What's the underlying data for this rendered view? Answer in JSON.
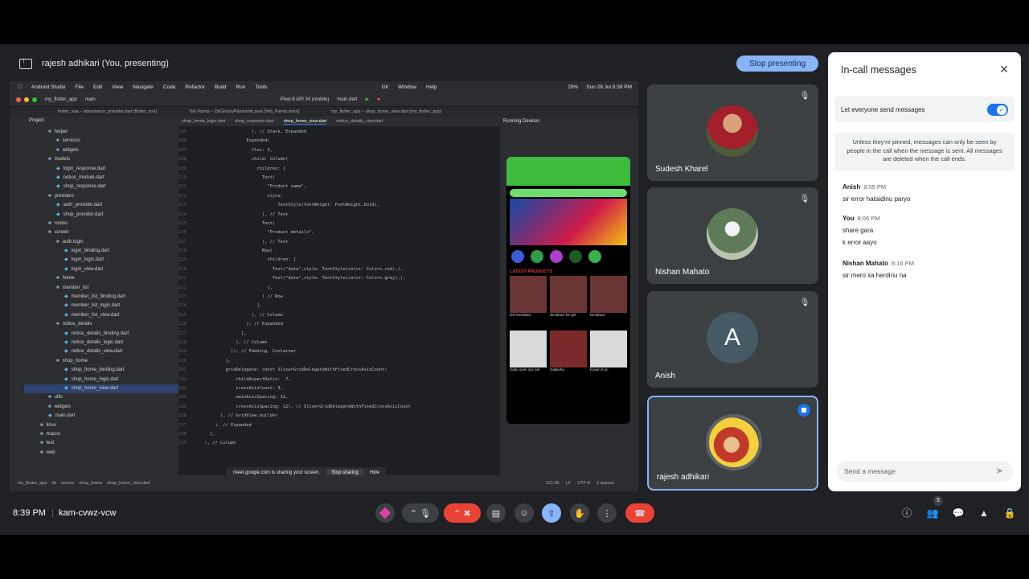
{
  "presenting": {
    "title": "rajesh adhikari (You, presenting)",
    "stop_label": "Stop presenting"
  },
  "shared_screen": {
    "mac_menu": [
      "Android Studio",
      "File",
      "Edit",
      "View",
      "Navigate",
      "Code",
      "Refactor",
      "Build",
      "Run",
      "Tools",
      "Git",
      "Window",
      "Help"
    ],
    "mac_status": {
      "battery": "29%",
      "datetime": "Sun 28 Jul  8:39 PM"
    },
    "toolbar": {
      "project": "my_flutter_app",
      "branch": "main",
      "device": "Pixel 8 API 34 (mobile)",
      "run_config": "main.dart"
    },
    "window_tabs": [
      "flutter_soa – attendance_provider.dart [flutter_soa]",
      "Yeti Paints – DbGlossyPaintsInfo.java [Yeti_Paints.main]",
      "my_flutter_app – shop_home_view.dart [my_flutter_app]"
    ],
    "project_label": "Project",
    "tree": [
      {
        "label": "helper",
        "indent": 3,
        "kind": "folder"
      },
      {
        "label": "services",
        "indent": 4,
        "kind": "folder"
      },
      {
        "label": "widgets",
        "indent": 4,
        "kind": "folder"
      },
      {
        "label": "models",
        "indent": 3,
        "kind": "folder"
      },
      {
        "label": "login_response.dart",
        "indent": 4,
        "kind": "file"
      },
      {
        "label": "notice_module.dart",
        "indent": 4,
        "kind": "file"
      },
      {
        "label": "shop_response.dart",
        "indent": 4,
        "kind": "file"
      },
      {
        "label": "providers",
        "indent": 3,
        "kind": "folder"
      },
      {
        "label": "auth_provider.dart",
        "indent": 4,
        "kind": "file"
      },
      {
        "label": "shop_provider.dart",
        "indent": 4,
        "kind": "file"
      },
      {
        "label": "routes",
        "indent": 3,
        "kind": "folder"
      },
      {
        "label": "screen",
        "indent": 3,
        "kind": "folder"
      },
      {
        "label": "auth.login",
        "indent": 4,
        "kind": "folder"
      },
      {
        "label": "login_binding.dart",
        "indent": 5,
        "kind": "file"
      },
      {
        "label": "login_logic.dart",
        "indent": 5,
        "kind": "file"
      },
      {
        "label": "login_view.dart",
        "indent": 5,
        "kind": "file"
      },
      {
        "label": "home",
        "indent": 4,
        "kind": "folder"
      },
      {
        "label": "member_list",
        "indent": 4,
        "kind": "folder"
      },
      {
        "label": "member_list_binding.dart",
        "indent": 5,
        "kind": "file"
      },
      {
        "label": "member_list_logic.dart",
        "indent": 5,
        "kind": "file"
      },
      {
        "label": "member_list_view.dart",
        "indent": 5,
        "kind": "file"
      },
      {
        "label": "notice_details",
        "indent": 4,
        "kind": "folder"
      },
      {
        "label": "notice_details_binding.dart",
        "indent": 5,
        "kind": "file"
      },
      {
        "label": "notice_details_logic.dart",
        "indent": 5,
        "kind": "file"
      },
      {
        "label": "notice_details_view.dart",
        "indent": 5,
        "kind": "file"
      },
      {
        "label": "shop_home",
        "indent": 4,
        "kind": "folder"
      },
      {
        "label": "shop_home_binding.dart",
        "indent": 5,
        "kind": "file"
      },
      {
        "label": "shop_home_logic.dart",
        "indent": 5,
        "kind": "file"
      },
      {
        "label": "shop_home_view.dart",
        "indent": 5,
        "kind": "file",
        "selected": true
      },
      {
        "label": "utils",
        "indent": 3,
        "kind": "folder"
      },
      {
        "label": "widgets",
        "indent": 3,
        "kind": "folder"
      },
      {
        "label": "main.dart",
        "indent": 3,
        "kind": "file"
      },
      {
        "label": "linux",
        "indent": 2,
        "kind": "folder"
      },
      {
        "label": "macos",
        "indent": 2,
        "kind": "folder"
      },
      {
        "label": "test",
        "indent": 2,
        "kind": "folder"
      },
      {
        "label": "web",
        "indent": 2,
        "kind": "folder"
      }
    ],
    "editor_tabs": [
      "shop_home_logic.dart",
      "shop_response.dart",
      "shop_home_view.dart",
      "notice_details_view.dart"
    ],
    "active_editor_tab": 2,
    "code": [
      {
        "n": "205",
        "t": "                    ), // Stack, Expanded"
      },
      {
        "n": "206",
        "t": "                  Expanded("
      },
      {
        "n": "207",
        "t": "                    flex: 3,"
      },
      {
        "n": "208",
        "t": "                    child: Column("
      },
      {
        "n": "209",
        "t": "                      children: ["
      },
      {
        "n": "210",
        "t": "                        Text("
      },
      {
        "n": "211",
        "t": "                          \"Product name\","
      },
      {
        "n": "212",
        "t": "                          style:"
      },
      {
        "n": "213",
        "t": "                              TextStyle(fontWeight: FontWeight.bold),"
      },
      {
        "n": "214",
        "t": "                        ), // Text"
      },
      {
        "n": "215",
        "t": "                        Text("
      },
      {
        "n": "216",
        "t": "                          \"Product details\","
      },
      {
        "n": "217",
        "t": "                        ), // Text"
      },
      {
        "n": "218",
        "t": "                        Row("
      },
      {
        "n": "219",
        "t": "                          children: ["
      },
      {
        "n": "220",
        "t": "                            Text(\"data\",style: TextStyle(color: Colors.red),),"
      },
      {
        "n": "221",
        "t": "                            Text(\"data\",style: TextStyle(color: Colors.grey),),"
      },
      {
        "n": "222",
        "t": "                          ],"
      },
      {
        "n": "223",
        "t": "                        ) // Row"
      },
      {
        "n": "224",
        "t": "                      ],"
      },
      {
        "n": "225",
        "t": "                    ), // Column"
      },
      {
        "n": "226",
        "t": "                  ), // Expanded"
      },
      {
        "n": "227",
        "t": "                ],"
      },
      {
        "n": "228",
        "t": "              ), // Column"
      },
      {
        "n": "229",
        "t": "            )); // Padding, Container"
      },
      {
        "n": "230",
        "t": "          },"
      },
      {
        "n": "231",
        "t": "          gridDelegate: const SliverGridDelegateWithFixedCrossAxisCount("
      },
      {
        "n": "232",
        "t": "              childAspectRatio: .7,"
      },
      {
        "n": "233",
        "t": "              crossAxisCount: 3,"
      },
      {
        "n": "234",
        "t": "              mainAxisSpacing: 12,"
      },
      {
        "n": "235",
        "t": "              crossAxisSpacing: 12), // SliverGridDelegateWithFixedCrossAxisCount"
      },
      {
        "n": "236",
        "t": "        ), // GridView.builder"
      },
      {
        "n": "237",
        "t": "      ), // Expanded"
      },
      {
        "n": "238",
        "t": "    ],"
      },
      {
        "n": "239",
        "t": "  ), // Column"
      }
    ],
    "running_devices_label": "Running Devices",
    "phone": {
      "latest_label": "LATEST PRODUCTS",
      "products": [
        "Girl Necklace",
        "Necklace for girl",
        "Necklace",
        "Sofa cover 1pc set",
        "Galaicha",
        "Kusan 5 pc"
      ]
    },
    "share_notice": {
      "text": "meet.google.com is sharing your screen.",
      "stop_label": "Stop sharing",
      "hide_label": "Hide"
    },
    "status_bar": {
      "path": [
        "my_flutter_app",
        "lib",
        "screen",
        "shop_home",
        "shop_home_view.dart"
      ],
      "position": "221:86",
      "line_ending": "LF",
      "encoding": "UTF-8",
      "indent": "2 spaces"
    }
  },
  "participants": [
    {
      "name": "Sudesh Kharel",
      "muted": true
    },
    {
      "name": "Nishan Mahato",
      "muted": true
    },
    {
      "name": "Anish",
      "initial": "A",
      "muted": true
    },
    {
      "name": "rajesh adhikari",
      "speaking": true
    }
  ],
  "chat": {
    "title": "In-call messages",
    "allow_label": "Let everyone send messages",
    "allow_enabled": true,
    "info": "Unless they're pinned, messages can only be seen by people in the call when the message is sent. All messages are deleted when the call ends.",
    "messages": [
      {
        "sender": "Anish",
        "time": "8:05 PM",
        "texts": [
          "sir error hataidinu paryo"
        ]
      },
      {
        "sender": "You",
        "time": "8:06 PM",
        "texts": [
          "share gara",
          "k error aayo"
        ]
      },
      {
        "sender": "Nishan Mahato",
        "time": "8:16 PM",
        "texts": [
          "sir mero xa herdinu na"
        ]
      }
    ],
    "input_placeholder": "Send a message"
  },
  "bottom": {
    "time": "8:39 PM",
    "divider": "|",
    "meeting_code": "kam-cvwz-vcw",
    "people_count": "5"
  },
  "colors": {
    "accent": "#8ab4f8",
    "hangup": "#ea4335",
    "mic_off": "#ea4335",
    "presenting": "#8ab4f8"
  }
}
